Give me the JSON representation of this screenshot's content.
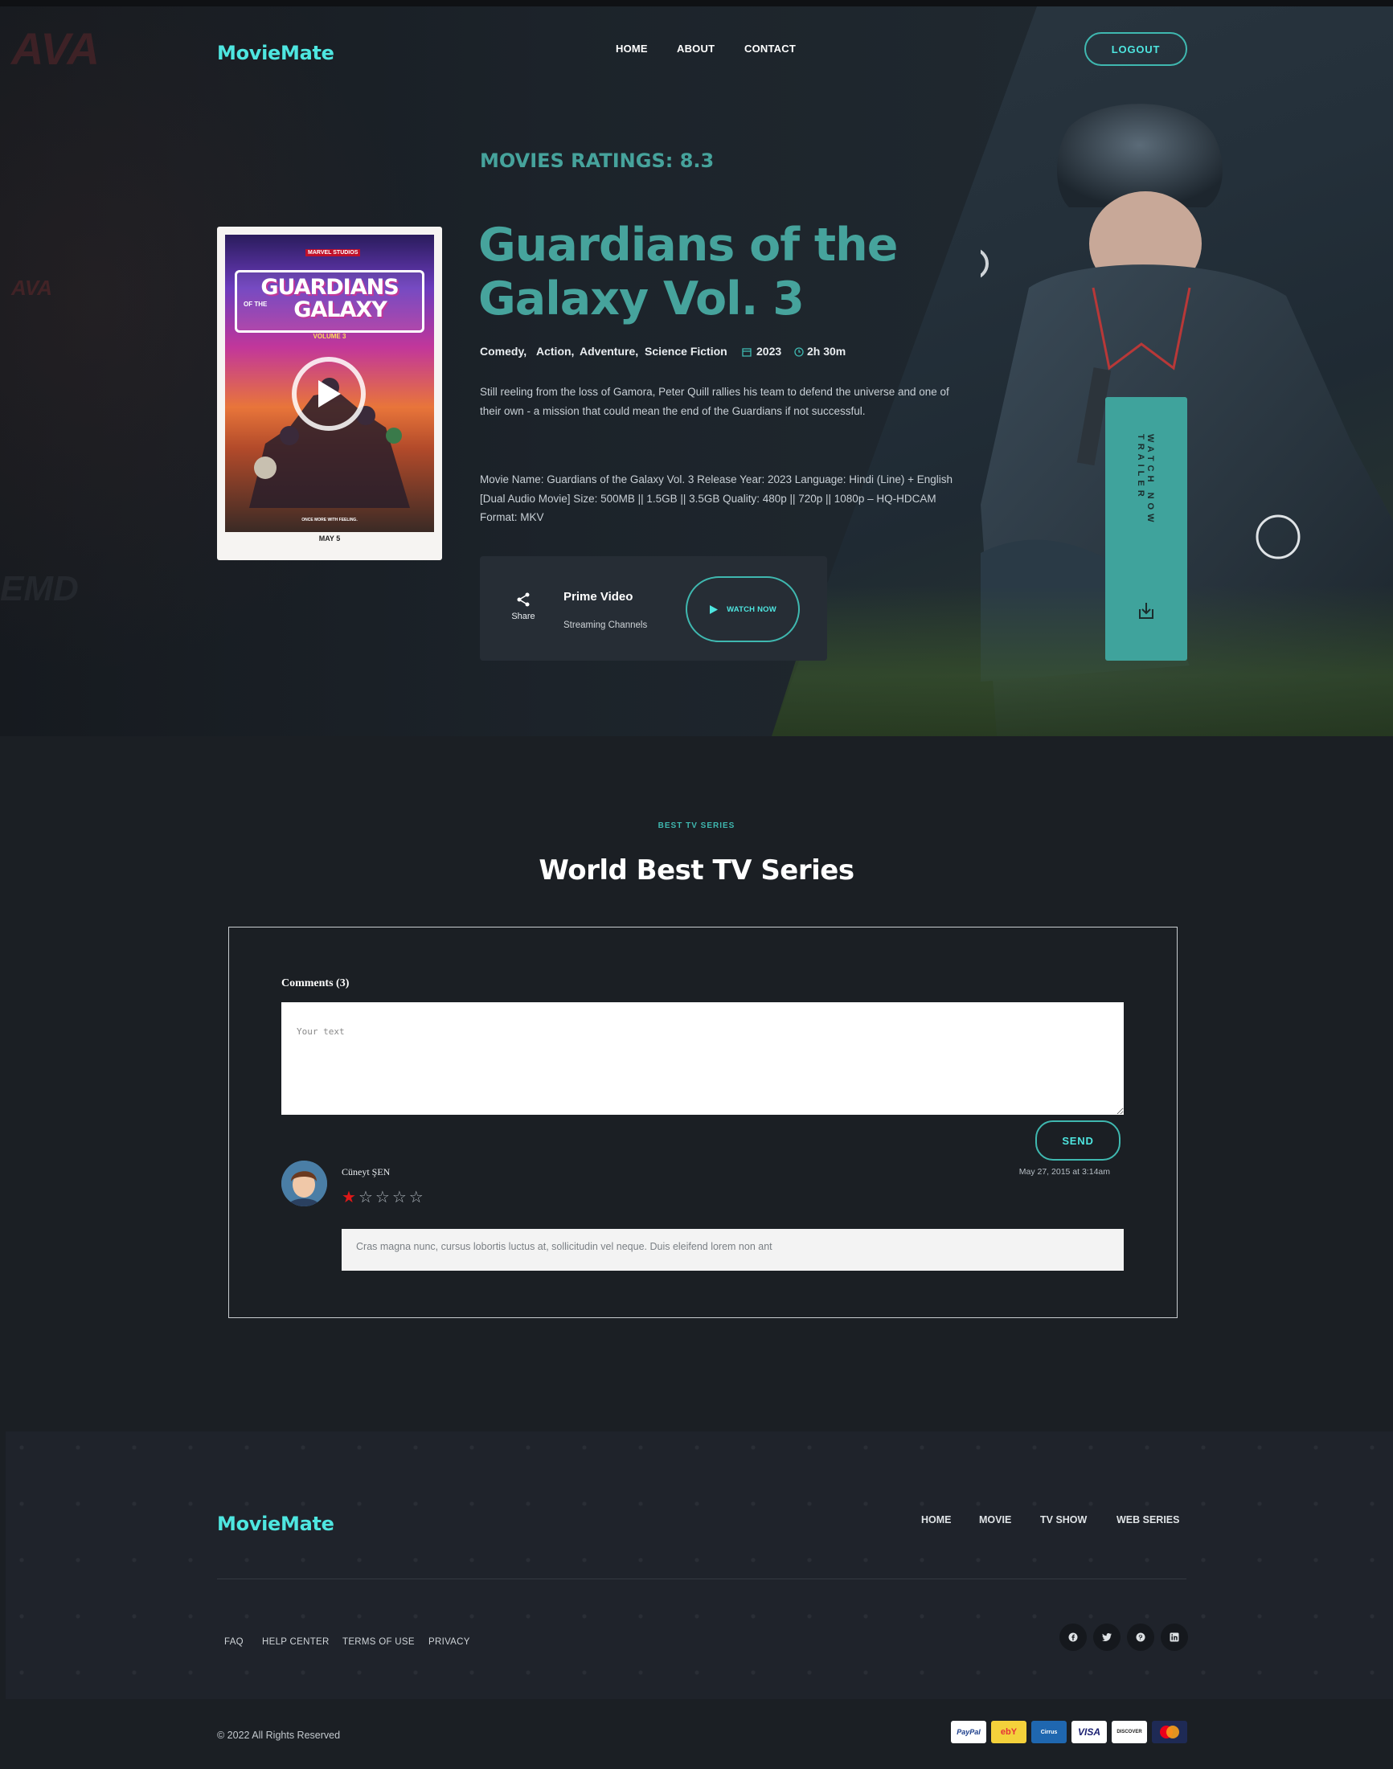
{
  "brand": {
    "name": "MovieMate"
  },
  "nav": {
    "home": "HOME",
    "about": "ABOUT",
    "contact": "CONTACT",
    "logout": "LOGOUT"
  },
  "hero": {
    "rating_label": "MOVIES RATINGS: 8.3",
    "title": "Guardians of the Galaxy Vol. 3",
    "genres": [
      "Comedy,",
      "Action,",
      "Adventure,",
      "Science Fiction"
    ],
    "year": "2023",
    "duration": "2h 30m",
    "description": "Still reeling from the loss of Gamora, Peter Quill rallies his team to defend the universe and one of their own - a mission that could mean the end of the Guardians if not successful.",
    "details": "Movie Name: Guardians of the Galaxy Vol. 3 Release Year: 2023 Language: Hindi (Line) + English [Dual Audio Movie] Size: 500MB || 1.5GB || 3.5GB Quality: 480p || 720p || 1080p – HQ-HDCAM Format: MKV",
    "poster": {
      "title_line1": "GUARDIANS",
      "of_the": "OF THE",
      "title_line2": "GALAXY",
      "volume": "VOLUME 3",
      "studio": "MARVEL STUDIOS",
      "tagline": "ONCE MORE WITH FEELING.",
      "date": "MAY 5"
    },
    "share_label": "Share",
    "stream_name": "Prime Video",
    "stream_sub": "Streaming Channels",
    "watch_label": "WATCH NOW",
    "trailer_label": "WATCH NOW TRAILER"
  },
  "section": {
    "kicker": "BEST TV SERIES",
    "title": "World Best TV Series"
  },
  "comments": {
    "heading": "Comments (3)",
    "placeholder": "Your text",
    "send_label": "SEND",
    "items": [
      {
        "author": "Cüneyt ŞEN",
        "date": "May 27, 2015 at 3:14am",
        "rating": 1,
        "max_rating": 5,
        "text": "Cras magna nunc, cursus lobortis luctus at, sollicitudin vel neque. Duis eleifend lorem non ant"
      }
    ]
  },
  "footer": {
    "brand": "MovieMate",
    "nav": [
      "HOME",
      "MOVIE",
      "TV SHOW",
      "WEB SERIES"
    ],
    "links": [
      "FAQ",
      "HELP CENTER",
      "TERMS OF USE",
      "PRIVACY"
    ],
    "social_icons": [
      "facebook-icon",
      "twitter-icon",
      "pinterest-icon",
      "linkedin-icon"
    ],
    "copyright": "© 2022 All Rights Reserved",
    "payments": [
      "PayPal",
      "ebY",
      "Cirrus",
      "VISA",
      "DISCOVER",
      "MasterCard"
    ]
  },
  "colors": {
    "accent": "#46a39c",
    "brand": "#4ee6e0",
    "background": "#1b1f24",
    "footer": "#1f232b",
    "star_active": "#e01818"
  }
}
